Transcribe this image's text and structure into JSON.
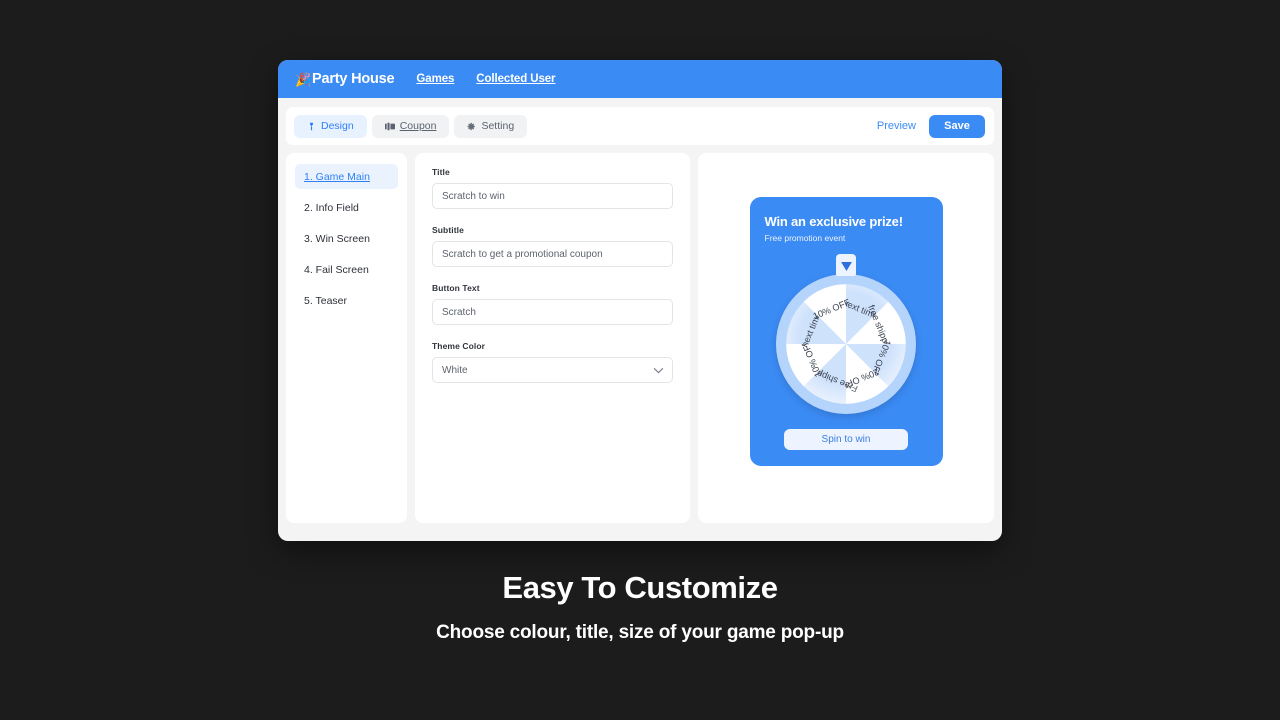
{
  "app": {
    "brand_icon": "party-popper-icon",
    "brand_name": "Party House",
    "nav": [
      {
        "label": "Games"
      },
      {
        "label": "Collected User"
      }
    ]
  },
  "toolbar": {
    "tabs": [
      {
        "label": "Design",
        "icon": "brush-icon",
        "active": true,
        "underline": false
      },
      {
        "label": "Coupon",
        "icon": "ticket-icon",
        "active": false,
        "underline": true
      },
      {
        "label": "Setting",
        "icon": "gear-icon",
        "active": false,
        "underline": false
      }
    ],
    "preview_label": "Preview",
    "save_label": "Save"
  },
  "steps": [
    {
      "label": "1. Game Main",
      "active": true
    },
    {
      "label": "2. Info Field",
      "active": false
    },
    {
      "label": "3. Win Screen",
      "active": false
    },
    {
      "label": "4. Fail Screen",
      "active": false
    },
    {
      "label": "5. Teaser",
      "active": false
    }
  ],
  "form": {
    "title": {
      "label": "Title",
      "value": "Scratch to win",
      "placeholder": "Scratch to win"
    },
    "subtitle": {
      "label": "Subtitle",
      "value": "Scratch to get a promotional coupon",
      "placeholder": "Scratch to get a promotional coupon"
    },
    "button_text": {
      "label": "Button Text",
      "value": "Scratch",
      "placeholder": "Scratch"
    },
    "theme_color": {
      "label": "Theme Color",
      "value": "White",
      "options": [
        "White"
      ]
    }
  },
  "preview": {
    "title": "Win an exclusive prize!",
    "subtitle": "Free promotion event",
    "spin_label": "Spin to win",
    "wheel": {
      "segments": [
        {
          "label": "next time",
          "fill": "#cfe2fc"
        },
        {
          "label": "free shipping",
          "fill": "#ffffff"
        },
        {
          "label": "10% OFF",
          "fill": "#cfe2fc"
        },
        {
          "label": "20% OFF",
          "fill": "#ffffff"
        },
        {
          "label": "Free shipping",
          "fill": "#cfe2fc"
        },
        {
          "label": "10% OFF",
          "fill": "#ffffff"
        },
        {
          "label": "next time",
          "fill": "#cfe2fc"
        },
        {
          "label": "10% OFF",
          "fill": "#ffffff"
        }
      ],
      "rim_color": "#b5d4fb",
      "pointer_icon": "triangle-down-icon"
    }
  },
  "caption": {
    "title": "Easy To Customize",
    "subtitle": "Choose colour, title, size of your game pop-up"
  },
  "colors": {
    "accent": "#3b8bf5",
    "background": "#1c1c1c",
    "window": "#f4f4f5"
  }
}
